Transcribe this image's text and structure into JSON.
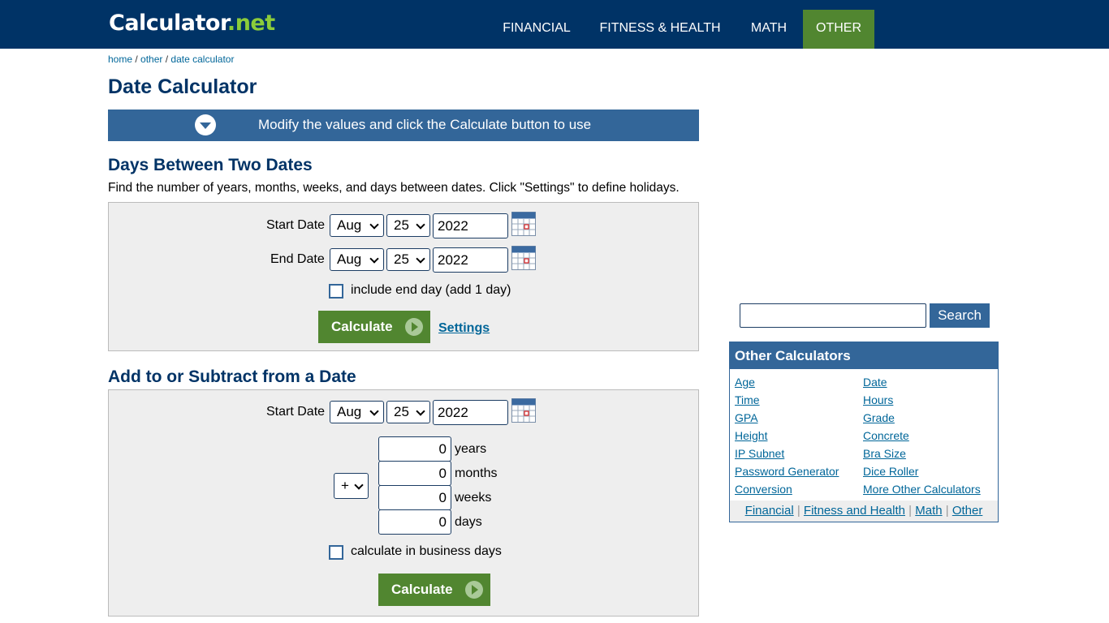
{
  "header": {
    "logo_main": "Calculator",
    "logo_dot": ".",
    "logo_net": "net",
    "nav": [
      "FINANCIAL",
      "FITNESS & HEALTH",
      "MATH",
      "OTHER"
    ]
  },
  "breadcrumb": {
    "home": "home",
    "sep": " / ",
    "other": "other",
    "current": "date calculator"
  },
  "title": "Date Calculator",
  "banner": "Modify the values and click the Calculate button to use",
  "section1": {
    "heading": "Days Between Two Dates",
    "desc": "Find the number of years, months, weeks, and days between dates. Click \"Settings\" to define holidays.",
    "start_label": "Start Date",
    "end_label": "End Date",
    "start": {
      "month": "Aug",
      "day": "25",
      "year": "2022"
    },
    "end": {
      "month": "Aug",
      "day": "25",
      "year": "2022"
    },
    "include_end": "include end day (add 1 day)",
    "calculate": "Calculate",
    "settings": "Settings"
  },
  "section2": {
    "heading": "Add to or Subtract from a Date",
    "start_label": "Start Date",
    "start": {
      "month": "Aug",
      "day": "25",
      "year": "2022"
    },
    "operator": "+",
    "years": "0",
    "years_label": "years",
    "months": "0",
    "months_label": "months",
    "weeks": "0",
    "weeks_label": "weeks",
    "days": "0",
    "days_label": "days",
    "business": "calculate in business days",
    "calculate": "Calculate"
  },
  "sidebar": {
    "search_button": "Search",
    "other_title": "Other Calculators",
    "links_left": [
      "Age",
      "Time",
      "GPA",
      "Height",
      "IP Subnet",
      "Password Generator",
      "Conversion"
    ],
    "links_right": [
      "Date",
      "Hours",
      "Grade",
      "Concrete",
      "Bra Size",
      "Dice Roller",
      "More Other Calculators"
    ],
    "footer": [
      "Financial",
      "Fitness and Health",
      "Math",
      "Other"
    ],
    "footer_sep": " | "
  },
  "colors": {
    "navy": "#003366",
    "blue": "#336699",
    "green": "#518630",
    "link": "#006699"
  }
}
